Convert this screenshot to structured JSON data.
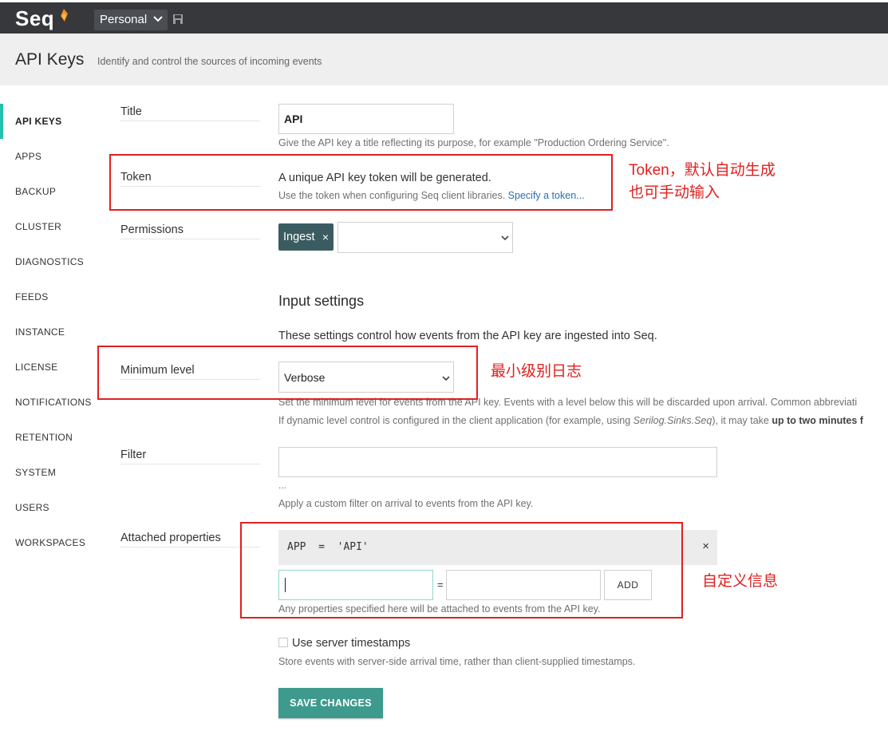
{
  "app": {
    "logo_text": "Seq",
    "workspace": "Personal"
  },
  "header": {
    "title": "API Keys",
    "subtitle": "Identify and control the sources of incoming events"
  },
  "nav": [
    {
      "label": "API KEYS",
      "active": true
    },
    {
      "label": "APPS"
    },
    {
      "label": "BACKUP"
    },
    {
      "label": "CLUSTER"
    },
    {
      "label": "DIAGNOSTICS"
    },
    {
      "label": "FEEDS"
    },
    {
      "label": "INSTANCE"
    },
    {
      "label": "LICENSE"
    },
    {
      "label": "NOTIFICATIONS"
    },
    {
      "label": "RETENTION"
    },
    {
      "label": "SYSTEM"
    },
    {
      "label": "USERS"
    },
    {
      "label": "WORKSPACES"
    }
  ],
  "form": {
    "title": {
      "label": "Title",
      "value": "API",
      "help": "Give the API key a title reflecting its purpose, for example \"Production Ordering Service\"."
    },
    "token": {
      "label": "Token",
      "text": "A unique API key token will be generated.",
      "help": "Use the token when configuring Seq client libraries.",
      "link": "Specify a token..."
    },
    "permissions": {
      "label": "Permissions",
      "tag": "Ingest",
      "tag_remove": "×"
    },
    "input_settings": {
      "heading": "Input settings",
      "description": "These settings control how events from the API key are ingested into Seq."
    },
    "minimum_level": {
      "label": "Minimum level",
      "value": "Verbose",
      "help1": "Set the minimum level for events from the API key. Events with a level below this will be discarded upon arrival. Common abbreviati",
      "help2_pre": "If dynamic level control is configured in the client application (for example, using ",
      "help2_em": "Serilog.Sinks.Seq",
      "help2_mid": "), it may take ",
      "help2_strong": "up to two minutes f"
    },
    "filter": {
      "label": "Filter",
      "value": "",
      "ellipsis": "...",
      "help": "Apply a custom filter on arrival to events from the API key."
    },
    "attached_properties": {
      "label": "Attached properties",
      "properties": [
        {
          "text": "APP  =  'API'"
        }
      ],
      "remove": "×",
      "equals": "=",
      "name_value": "",
      "value_value": "",
      "add_label": "ADD",
      "help": "Any properties specified here will be attached to events from the API key."
    },
    "server_timestamps": {
      "label": "Use server timestamps",
      "checked": false,
      "help": "Store events with server-side arrival time, rather than client-supplied timestamps."
    },
    "save_label": "SAVE CHANGES"
  },
  "annotations": {
    "token_line1": "Token，默认自动生成",
    "token_line2": "也可手动输入",
    "level": "最小级别日志",
    "props": "自定义信息"
  },
  "colors": {
    "topbar": "#36383c",
    "accent": "#23c1ae",
    "tag": "#3a5c61",
    "save_button": "#3e9a8d",
    "annotation": "#e02020"
  }
}
